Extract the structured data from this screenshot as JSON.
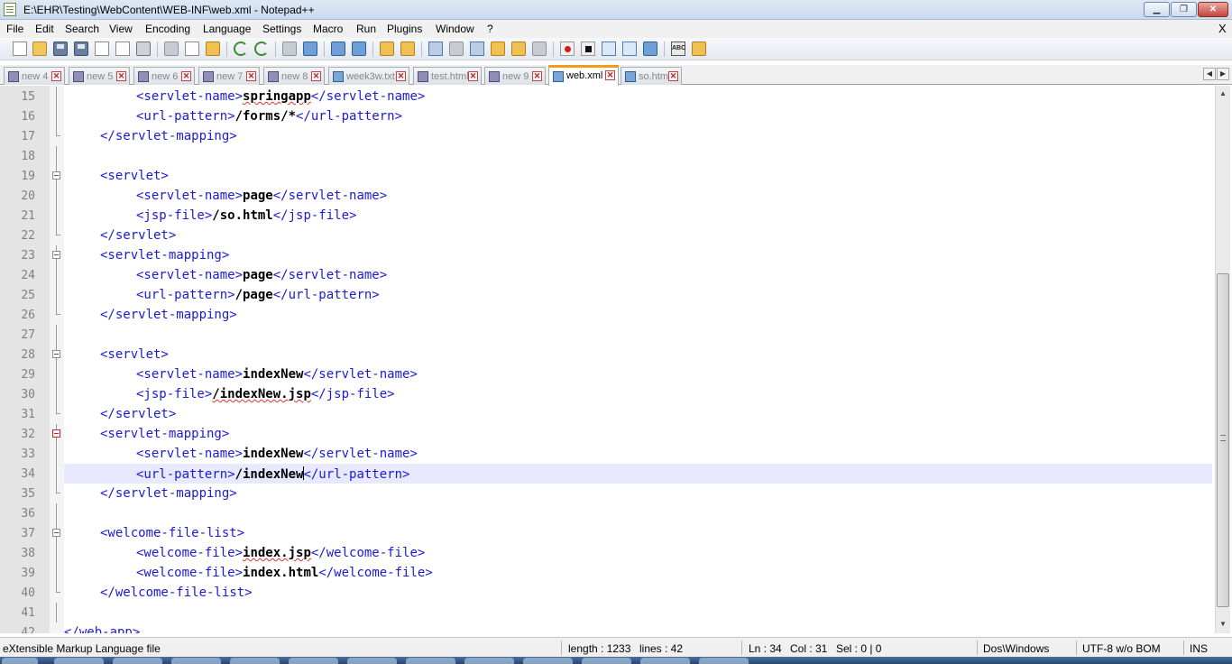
{
  "window": {
    "title": "E:\\EHR\\Testing\\WebContent\\WEB-INF\\web.xml - Notepad++",
    "buttons": {
      "minimize": "▁",
      "maximize": "❐",
      "close": "✕"
    }
  },
  "menu": {
    "items": [
      "File",
      "Edit",
      "Search",
      "View",
      "Encoding",
      "Language",
      "Settings",
      "Macro",
      "Run",
      "Plugins",
      "Window",
      "?"
    ],
    "close_doc": "X"
  },
  "toolbar": {
    "buttons": [
      {
        "name": "new-file-icon"
      },
      {
        "name": "open-file-icon"
      },
      {
        "name": "save-icon"
      },
      {
        "name": "save-all-icon"
      },
      {
        "name": "close-icon"
      },
      {
        "name": "close-all-icon"
      },
      {
        "name": "print-icon"
      },
      {
        "name": "cut-icon"
      },
      {
        "name": "copy-icon"
      },
      {
        "name": "paste-icon"
      },
      {
        "name": "undo-icon"
      },
      {
        "name": "redo-icon"
      },
      {
        "name": "find-icon"
      },
      {
        "name": "replace-icon"
      },
      {
        "name": "zoom-in-icon"
      },
      {
        "name": "zoom-out-icon"
      },
      {
        "name": "sync-vertical-icon"
      },
      {
        "name": "sync-horizontal-icon"
      },
      {
        "name": "word-wrap-icon"
      },
      {
        "name": "show-all-chars-icon"
      },
      {
        "name": "indent-guide-icon"
      },
      {
        "name": "user-lang-icon"
      },
      {
        "name": "doc-map-icon"
      },
      {
        "name": "function-list-icon"
      },
      {
        "name": "record-macro-icon"
      },
      {
        "name": "stop-macro-icon"
      },
      {
        "name": "play-macro-icon"
      },
      {
        "name": "run-macro-multiple-icon"
      },
      {
        "name": "save-macro-icon"
      },
      {
        "name": "spell-check-icon",
        "label": "ABC"
      },
      {
        "name": "plugin-icon"
      }
    ]
  },
  "tabs": [
    {
      "label": "new  4",
      "active": false,
      "icon": "purple"
    },
    {
      "label": "new  5",
      "active": false,
      "icon": "purple"
    },
    {
      "label": "new  6",
      "active": false,
      "icon": "purple"
    },
    {
      "label": "new  7",
      "active": false,
      "icon": "purple"
    },
    {
      "label": "new  8",
      "active": false,
      "icon": "purple"
    },
    {
      "label": "week3w.txt",
      "active": false,
      "icon": "blue"
    },
    {
      "label": "test.html",
      "active": false,
      "icon": "purple"
    },
    {
      "label": "new  9",
      "active": false,
      "icon": "purple"
    },
    {
      "label": "web.xml",
      "active": true,
      "icon": "blue"
    },
    {
      "label": "so.html",
      "active": false,
      "icon": "blue"
    }
  ],
  "tab_close_glyph": "✕",
  "tab_scroll": {
    "left": "◀",
    "right": "▶"
  },
  "editor": {
    "current_line": 34,
    "lines": [
      {
        "n": "15",
        "indent": 2,
        "open": "<servlet-name>",
        "text": "springapp",
        "close": "</servlet-name>",
        "squig": true,
        "fold": "bar"
      },
      {
        "n": "16",
        "indent": 2,
        "open": "<url-pattern>",
        "text": "/forms/*",
        "close": "</url-pattern>",
        "fold": "bar"
      },
      {
        "n": "17",
        "indent": 1,
        "open": "</servlet-mapping>",
        "fold": "end"
      },
      {
        "n": "18",
        "indent": 0,
        "fold": "bar"
      },
      {
        "n": "19",
        "indent": 1,
        "open": "<servlet>",
        "fold": "box"
      },
      {
        "n": "20",
        "indent": 2,
        "open": "<servlet-name>",
        "text": "page",
        "close": "</servlet-name>",
        "fold": "bar"
      },
      {
        "n": "21",
        "indent": 2,
        "open": "<jsp-file>",
        "text": "/so.html",
        "close": "</jsp-file>",
        "fold": "bar"
      },
      {
        "n": "22",
        "indent": 1,
        "open": "</servlet>",
        "fold": "end"
      },
      {
        "n": "23",
        "indent": 1,
        "open": "<servlet-mapping>",
        "fold": "box"
      },
      {
        "n": "24",
        "indent": 2,
        "open": "<servlet-name>",
        "text": "page",
        "close": "</servlet-name>",
        "fold": "bar"
      },
      {
        "n": "25",
        "indent": 2,
        "open": "<url-pattern>",
        "text": "/page",
        "close": "</url-pattern>",
        "fold": "bar"
      },
      {
        "n": "26",
        "indent": 1,
        "open": "</servlet-mapping>",
        "fold": "end"
      },
      {
        "n": "27",
        "indent": 0,
        "fold": "bar"
      },
      {
        "n": "28",
        "indent": 1,
        "open": "<servlet>",
        "fold": "box"
      },
      {
        "n": "29",
        "indent": 2,
        "open": "<servlet-name>",
        "text": "indexNew",
        "close": "</servlet-name>",
        "fold": "bar"
      },
      {
        "n": "30",
        "indent": 2,
        "open": "<jsp-file>",
        "text": "/indexNew.jsp",
        "close": "</jsp-file>",
        "squig": true,
        "fold": "bar"
      },
      {
        "n": "31",
        "indent": 1,
        "open": "</servlet>",
        "fold": "end"
      },
      {
        "n": "32",
        "indent": 1,
        "open": "<servlet-mapping>",
        "fold": "box-red"
      },
      {
        "n": "33",
        "indent": 2,
        "open": "<servlet-name>",
        "text": "indexNew",
        "close": "</servlet-name>",
        "fold": "bar"
      },
      {
        "n": "34",
        "indent": 2,
        "open": "<url-pattern>",
        "text": "/indexNew",
        "close": "</url-pattern>",
        "caret": true,
        "fold": "bar"
      },
      {
        "n": "35",
        "indent": 1,
        "open": "</servlet-mapping>",
        "fold": "end"
      },
      {
        "n": "36",
        "indent": 0,
        "fold": "bar"
      },
      {
        "n": "37",
        "indent": 1,
        "open": "<welcome-file-list>",
        "fold": "box"
      },
      {
        "n": "38",
        "indent": 2,
        "open": "<welcome-file>",
        "text": "index.jsp",
        "close": "</welcome-file>",
        "squig": true,
        "fold": "bar"
      },
      {
        "n": "39",
        "indent": 2,
        "open": "<welcome-file>",
        "text": "index.html",
        "close": "</welcome-file>",
        "fold": "bar"
      },
      {
        "n": "40",
        "indent": 1,
        "open": "</welcome-file-list>",
        "fold": "end"
      },
      {
        "n": "41",
        "indent": 0,
        "fold": "bar"
      },
      {
        "n": "42",
        "indent": 0,
        "open": "</web-app>",
        "fold": "none"
      }
    ]
  },
  "scrollbar": {
    "up": "▲",
    "down": "▼"
  },
  "status": {
    "file_type": "eXtensible Markup Language file",
    "length": "length : 1233",
    "lines": "lines : 42",
    "ln": "Ln : 34",
    "col": "Col : 31",
    "sel": "Sel : 0 | 0",
    "eol": "Dos\\Windows",
    "encoding": "UTF-8 w/o BOM",
    "mode": "INS"
  },
  "colors": {
    "tag": "#1a1ad6",
    "text": "#000000",
    "current_line": "#e8e8ff",
    "active_tab_accent": "#f29b1d"
  }
}
